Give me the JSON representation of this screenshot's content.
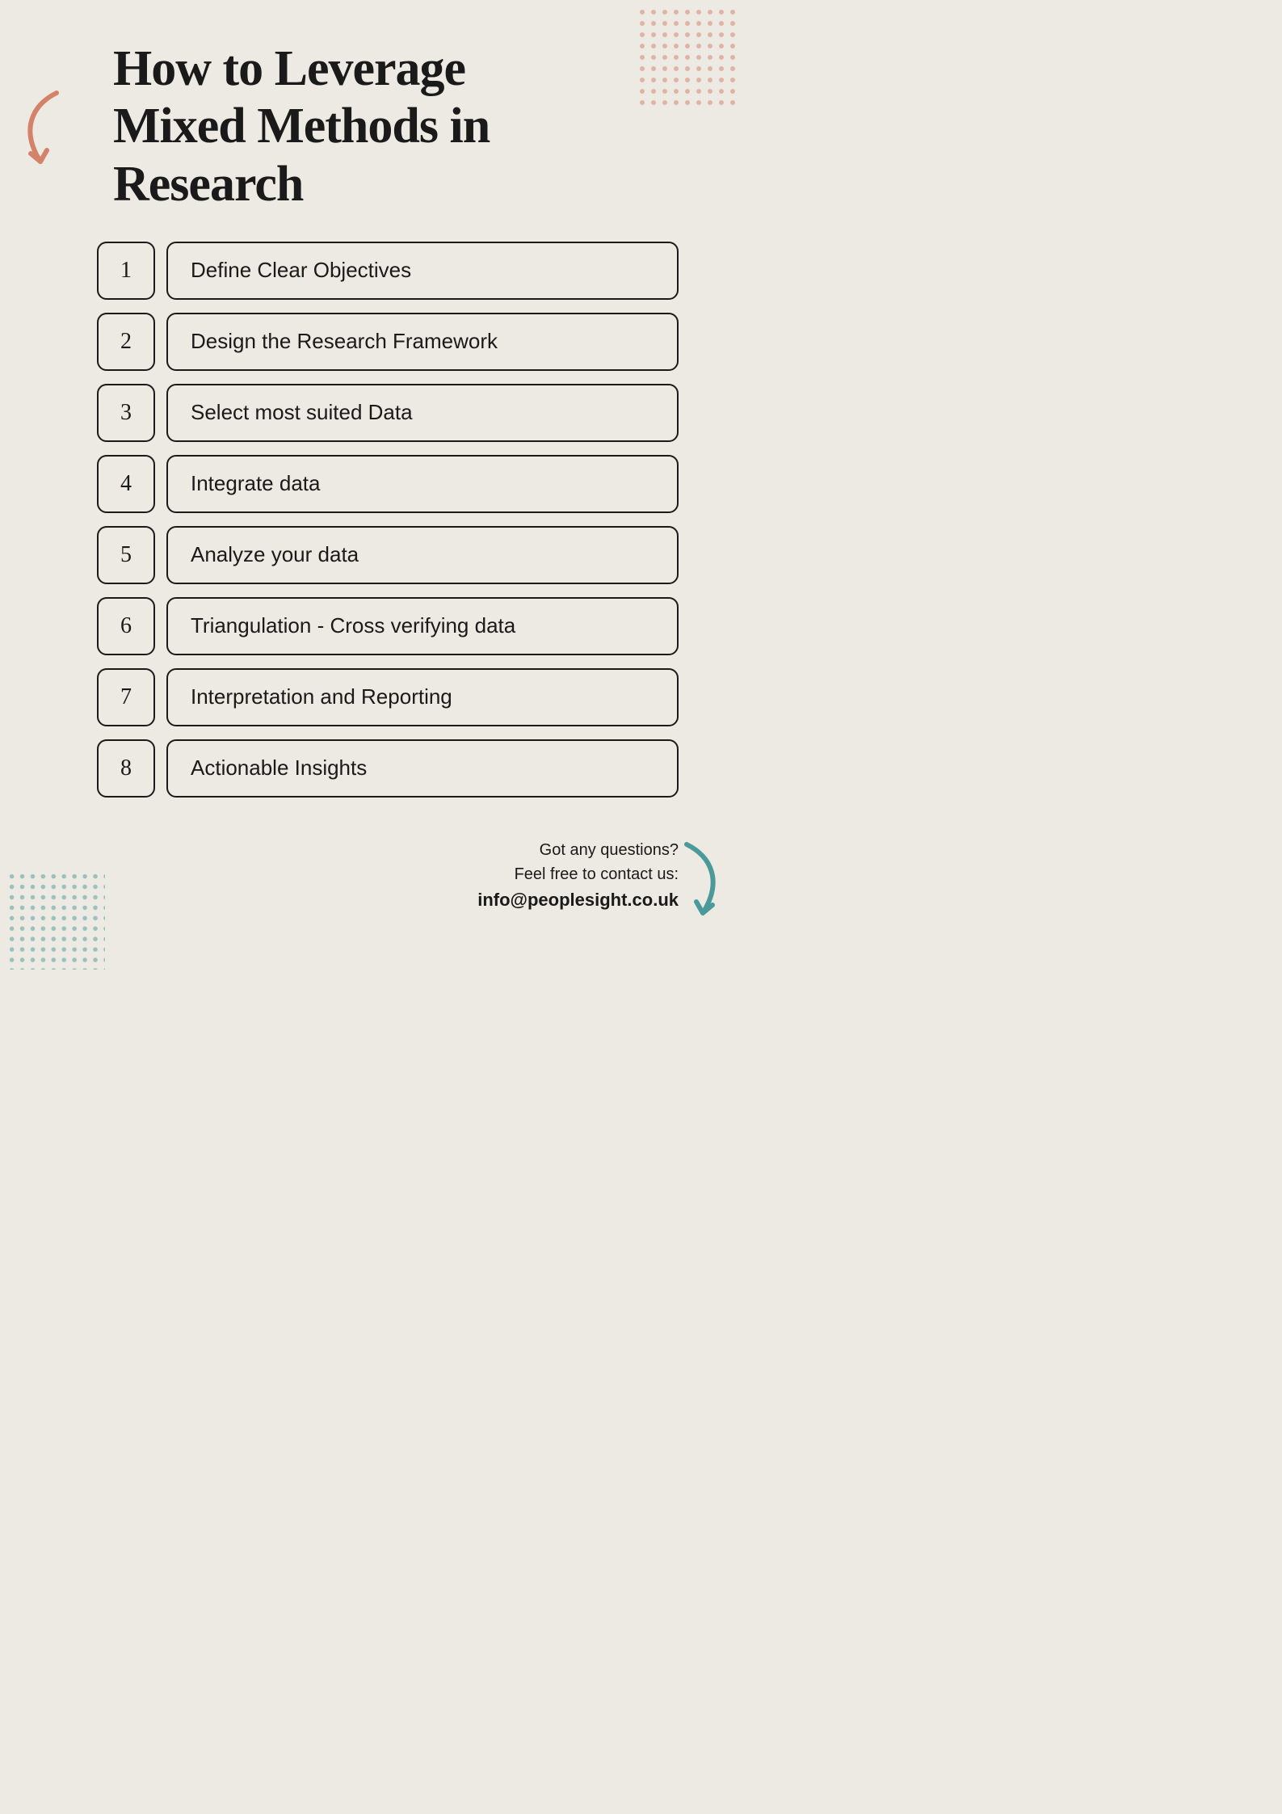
{
  "title": {
    "line1": "How to Leverage",
    "line2": "Mixed Methods in",
    "line3": "Research"
  },
  "steps": [
    {
      "number": "1",
      "label": "Define Clear Objectives"
    },
    {
      "number": "2",
      "label": "Design the Research Framework"
    },
    {
      "number": "3",
      "label": "Select most suited Data"
    },
    {
      "number": "4",
      "label": "Integrate data"
    },
    {
      "number": "5",
      "label": "Analyze your data"
    },
    {
      "number": "6",
      "label": "Triangulation - Cross verifying data"
    },
    {
      "number": "7",
      "label": "Interpretation and Reporting"
    },
    {
      "number": "8",
      "label": "Actionable Insights"
    }
  ],
  "footer": {
    "line1": "Got any questions?",
    "line2": "Feel free to contact us:",
    "email": "info@peoplesight.co.uk"
  },
  "arrows": {
    "top_left": "↙",
    "bottom_right": "↘"
  }
}
